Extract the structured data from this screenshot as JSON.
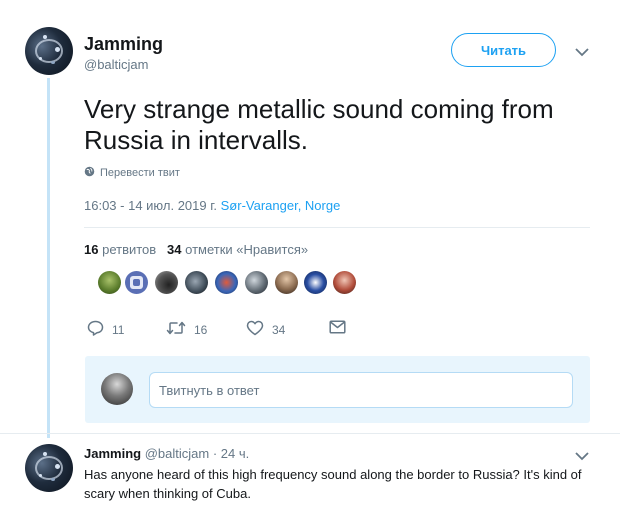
{
  "tweet": {
    "author_name": "Jamming",
    "author_handle": "@balticjam",
    "follow_label": "Читать",
    "text": "Very strange metallic sound coming from Russia in intervalls.",
    "translate_label": "Перевести твит",
    "timestamp": "16:03 - 14 июл. 2019 г.",
    "location": "Sør-Varanger, Norge",
    "retweets_count": "16",
    "retweets_label": "ретвитов",
    "likes_count": "34",
    "likes_label": "отметки «Нравится»",
    "actions": {
      "reply_count": "11",
      "retweet_count": "16",
      "like_count": "34"
    }
  },
  "reply_composer": {
    "placeholder": "Твитнуть в ответ"
  },
  "reply": {
    "author_name": "Jamming",
    "author_handle": "@balticjam",
    "time": "· 24 ч.",
    "text": "Has anyone heard of this high frequency sound along the border to Russia? It's kind of scary when thinking of Cuba."
  },
  "icons": [
    "globe-icon",
    "chevron-down-icon",
    "reply-icon",
    "retweet-icon",
    "heart-icon",
    "message-icon"
  ],
  "colors": {
    "accent": "#1da1f2",
    "muted": "#657786",
    "text": "#14171a",
    "composer_bg": "#e8f5fd",
    "thread_line": "#c4e3f7"
  }
}
